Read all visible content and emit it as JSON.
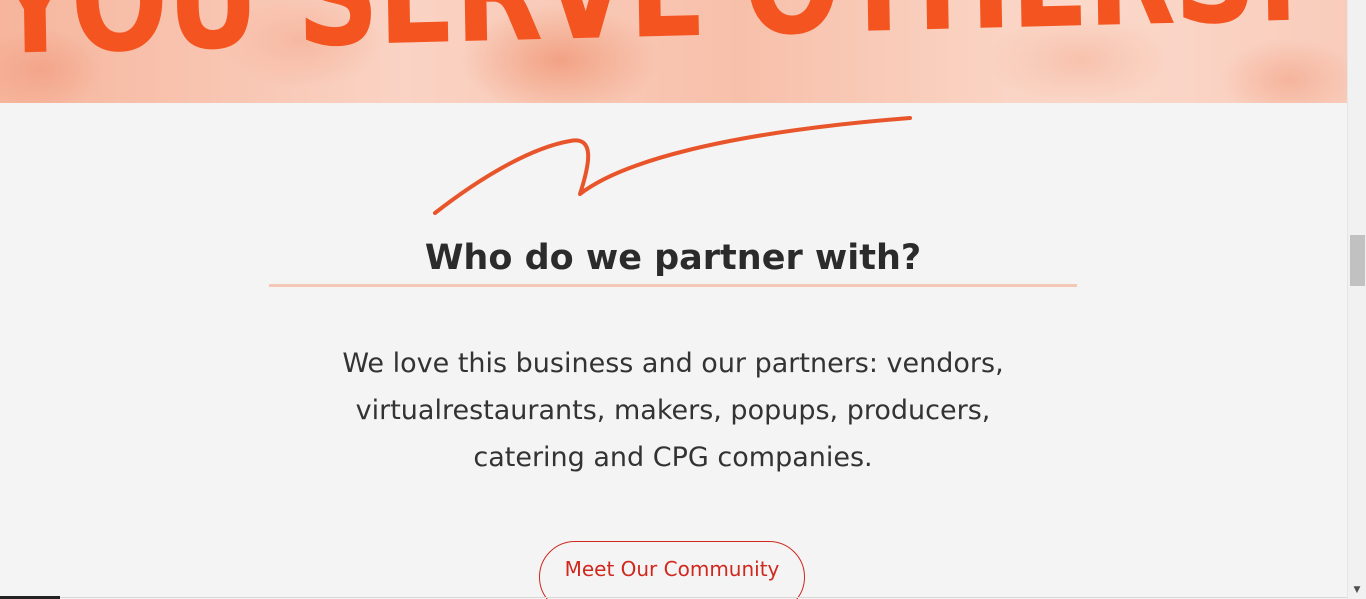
{
  "hero": {
    "banner_text": "YOU SERVE OTHERS:"
  },
  "section": {
    "heading": "Who do we partner with?",
    "body": "We love this business and our partners: vendors, virtualrestaurants, makers, popups, producers, catering and CPG companies.",
    "cta_label": "Meet Our Community"
  },
  "colors": {
    "accent": "#f4541f",
    "cta": "#d0281f",
    "heading_rule": "#f5c7b5",
    "background": "#f4f4f4"
  },
  "icons": {
    "squiggle": "decorative-squiggle-icon",
    "scroll_down": "scroll-down-arrow-icon"
  }
}
